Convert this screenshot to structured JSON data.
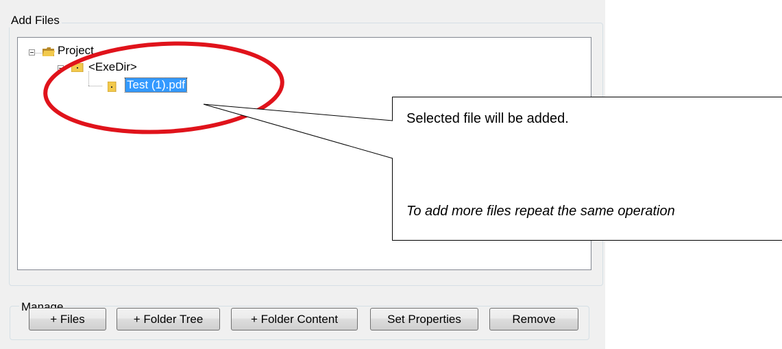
{
  "add_files": {
    "title": "Add Files",
    "tree": {
      "root_label": "Project",
      "child_label": "<ExeDir>",
      "file_label": "Test (1).pdf"
    }
  },
  "manage": {
    "title": "Manage",
    "buttons": {
      "files": "+ Files",
      "folder_tree": "+ Folder Tree",
      "folder_content": "+ Folder Content",
      "set_properties": "Set Properties",
      "remove": "Remove"
    }
  },
  "callout": {
    "line1": "Selected file will be added.",
    "line2": "To add more files repeat the same operation"
  },
  "colors": {
    "selection": "#3399ff",
    "annotation_circle": "#e0131b",
    "folder": "#f2c94c"
  },
  "icons": [
    "folder-icon",
    "collapse-icon"
  ]
}
